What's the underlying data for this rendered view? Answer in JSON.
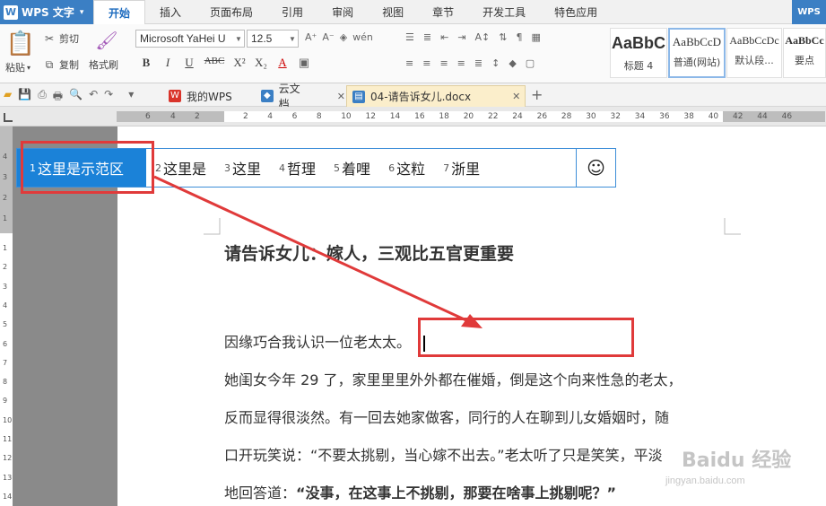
{
  "app": {
    "name": "WPS 文字",
    "corner_label": "WPS"
  },
  "menu": {
    "tabs": [
      "开始",
      "插入",
      "页面布局",
      "引用",
      "审阅",
      "视图",
      "章节",
      "开发工具",
      "特色应用"
    ],
    "active": "开始"
  },
  "ribbon": {
    "paste_label": "粘贴",
    "cut_label": "剪切",
    "copy_label": "复制",
    "format_painter_label": "格式刷",
    "font_name": "Microsoft YaHei U",
    "font_size": "12.5",
    "format_buttons": [
      "B",
      "I",
      "U",
      "ABC",
      "X²",
      "X₂"
    ],
    "styles": [
      {
        "sample": "AaBbC",
        "name": "标题 4"
      },
      {
        "sample": "AaBbCcD",
        "name": "普通(网站)"
      },
      {
        "sample": "AaBbCcDc",
        "name": "默认段..."
      },
      {
        "sample": "AaBbCc",
        "name": "要点"
      }
    ]
  },
  "doc_tabs": [
    {
      "label": "我的WPS",
      "icon_color": "#d9342b"
    },
    {
      "label": "云文档",
      "icon_color": "#3b7fc4"
    },
    {
      "label": "04-请告诉女儿.docx",
      "icon_color": "#3b7fc4"
    }
  ],
  "ruler": {
    "top_numbers": [
      "6",
      "4",
      "2",
      "2",
      "4",
      "6",
      "8",
      "10",
      "12",
      "14",
      "16",
      "18",
      "20",
      "22",
      "24",
      "26",
      "28",
      "30",
      "32",
      "34",
      "36",
      "38",
      "40",
      "42",
      "44",
      "46"
    ],
    "left_numbers": [
      "4",
      "3",
      "2",
      "1",
      "1",
      "2",
      "3",
      "4",
      "5",
      "6",
      "7",
      "8",
      "9",
      "10",
      "11",
      "12",
      "13",
      "14"
    ]
  },
  "tabbar": {
    "items": [
      {
        "num": "1",
        "label": "这里是示范区"
      },
      {
        "num": "2",
        "label": "这里是"
      },
      {
        "num": "3",
        "label": "这里"
      },
      {
        "num": "4",
        "label": "哲理"
      },
      {
        "num": "5",
        "label": "着哩"
      },
      {
        "num": "6",
        "label": "这粒"
      },
      {
        "num": "7",
        "label": "浙里"
      }
    ],
    "emoji": "☺"
  },
  "document": {
    "title": "请告诉女儿：嫁人，三观比五官更重要",
    "lines": [
      "因缘巧合我认识一位老太太。",
      "她闺女今年 29 了，家里里里外外都在催婚，倒是这个向来性急的老太，",
      "反而显得很淡然。有一回去她家做客，同行的人在聊到儿女婚姻时，随",
      "口开玩笑说：“不要太挑剔，当心嫁不出去。”老太听了只是笑笑，平淡",
      "地回答道："
    ],
    "bold_quote": "“没事，在这事上不挑剔，那要在啥事上挑剔呢？”"
  },
  "watermark": {
    "main": "Baidu 经验",
    "sub": "jingyan.baidu.com"
  }
}
